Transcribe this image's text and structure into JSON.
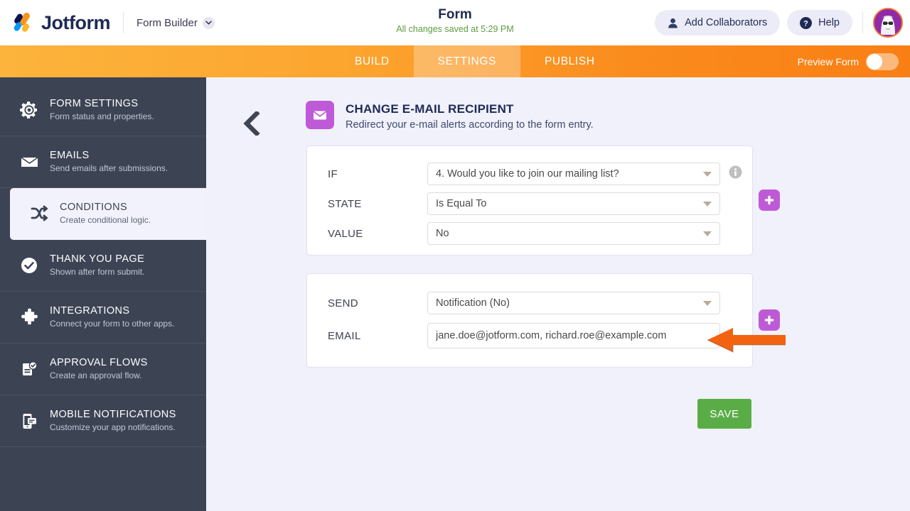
{
  "header": {
    "logo_text": "Jotform",
    "logo_icon": "jotform-logo-icon",
    "form_builder_label": "Form Builder",
    "chevron_icon": "chevron-down-icon",
    "title": "Form",
    "save_status": "All changes saved at 5:29 PM",
    "add_collaborators_label": "Add Collaborators",
    "collaborators_icon": "person-icon",
    "help_label": "Help",
    "help_icon": "question-mark-icon",
    "avatar_icon": "user-avatar"
  },
  "navbar": {
    "tabs": [
      {
        "label": "BUILD",
        "active": false
      },
      {
        "label": "SETTINGS",
        "active": true
      },
      {
        "label": "PUBLISH",
        "active": false
      }
    ],
    "preview_label": "Preview Form",
    "preview_toggle_state": "off"
  },
  "sidebar": {
    "items": [
      {
        "title": "FORM SETTINGS",
        "desc": "Form status and properties.",
        "icon": "gear-icon",
        "active": false
      },
      {
        "title": "EMAILS",
        "desc": "Send emails after submissions.",
        "icon": "envelope-icon",
        "active": false
      },
      {
        "title": "CONDITIONS",
        "desc": "Create conditional logic.",
        "icon": "shuffle-icon",
        "active": true
      },
      {
        "title": "THANK YOU PAGE",
        "desc": "Shown after form submit.",
        "icon": "check-circle-icon",
        "active": false
      },
      {
        "title": "INTEGRATIONS",
        "desc": "Connect your form to other apps.",
        "icon": "puzzle-piece-icon",
        "active": false
      },
      {
        "title": "APPROVAL FLOWS",
        "desc": "Create an approval flow.",
        "icon": "approval-document-icon",
        "active": false
      },
      {
        "title": "MOBILE NOTIFICATIONS",
        "desc": "Customize your app notifications.",
        "icon": "mobile-notification-icon",
        "active": false
      }
    ]
  },
  "panel": {
    "back_icon": "back-chevron-icon",
    "badge_icon": "envelope-icon",
    "title": "CHANGE E-MAIL RECIPIENT",
    "subtitle": "Redirect your e-mail alerts according to the form entry.",
    "condition_card": {
      "rows": [
        {
          "label": "IF",
          "value": "4. Would you like to join our mailing list?",
          "type": "select",
          "info": true
        },
        {
          "label": "STATE",
          "value": "Is Equal To",
          "type": "select",
          "info": false
        },
        {
          "label": "VALUE",
          "value": "No",
          "type": "select",
          "info": false
        }
      ],
      "add_button_icon": "plus-icon"
    },
    "action_card": {
      "rows": [
        {
          "label": "SEND",
          "value": "Notification (No)",
          "type": "select",
          "info": false
        },
        {
          "label": "EMAIL",
          "value": "jane.doe@jotform.com, richard.roe@example.com",
          "placeholder": "",
          "type": "text",
          "info": false
        }
      ],
      "add_button_icon": "plus-icon"
    },
    "annotation_arrow": {
      "icon": "arrow-left-annotation",
      "color": "#f2620f",
      "points_to": "EMAIL"
    },
    "save_label": "SAVE"
  },
  "colors": {
    "accent_purple": "#bf5ad6",
    "nav_orange": "#fa8a1c",
    "save_green": "#5aad46",
    "sidebar_dark": "#3c4454",
    "status_green": "#5f9b41",
    "annotation_orange": "#f2620f"
  }
}
